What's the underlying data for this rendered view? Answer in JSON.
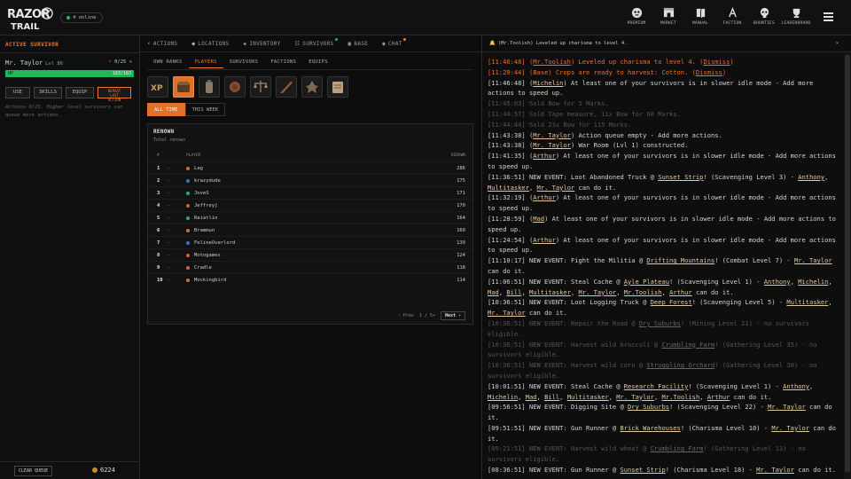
{
  "header": {
    "logo_text": "RAZOR TRAIL",
    "online_count": "4 online",
    "nav": [
      {
        "icon": "premium-icon",
        "label": "PREMIUM"
      },
      {
        "icon": "market-icon",
        "label": "MARKET"
      },
      {
        "icon": "manual-icon",
        "label": "MANUAL"
      },
      {
        "icon": "faction-icon",
        "label": "FACTION"
      },
      {
        "icon": "bounties-icon",
        "label": "BOUNTIES"
      },
      {
        "icon": "leaderboard-icon",
        "label": "LEADERBOARD"
      }
    ]
  },
  "left": {
    "title": "ACTIVE SURVIVOR",
    "survivor_name": "Mr. Taylor",
    "survivor_level": "Lvl 86",
    "actions": "0/25",
    "hp_label": "HP",
    "hp_value": "183/183",
    "hp_fraction": 1.0,
    "buttons": {
      "use": "USE",
      "skills": "SKILLS",
      "equip": "EQUIP",
      "repeat": "REPEAT LAST ACTION"
    },
    "note": "Actions 0/25. Higher level survivors can queue more actions.",
    "clear_queue": "CLEAR QUEUE",
    "coins": "6224"
  },
  "main": {
    "tabs": [
      {
        "icon": "⚡",
        "label": "ACTIONS"
      },
      {
        "icon": "●",
        "label": "LOCATIONS"
      },
      {
        "icon": "◈",
        "label": "INVENTORY"
      },
      {
        "icon": "☷",
        "label": "SURVIVORS"
      },
      {
        "icon": "▣",
        "label": "BASE"
      },
      {
        "icon": "◉",
        "label": "CHAT"
      }
    ],
    "subtabs": [
      "OWN RANKS",
      "PLAYERS",
      "SURVIVORS",
      "FACTIONS",
      "EQUIPS"
    ],
    "categories": [
      "xp-icon",
      "renown-crate-icon",
      "canteen-icon",
      "coin-icon",
      "scales-icon",
      "knife-icon",
      "creature-icon",
      "scroll-icon"
    ],
    "time_tabs": [
      "ALL TIME",
      "THIS WEEK"
    ],
    "board": {
      "title": "RENOWN",
      "subtitle": "Total renown",
      "col_rank": "#",
      "col_player": "PLAYER",
      "col_value": "RENOWN",
      "rows": [
        {
          "rank": "1",
          "change": "–",
          "color": "#c9713a",
          "name": "Lag",
          "value": "286"
        },
        {
          "rank": "2",
          "change": "–",
          "color": "#3a73c9",
          "name": "krazydude",
          "value": "175"
        },
        {
          "rank": "3",
          "change": "–",
          "color": "#1fb85a",
          "name": "JoveS",
          "value": "171"
        },
        {
          "rank": "4",
          "change": "–",
          "color": "#e05a40",
          "name": "Jeffreyj",
          "value": "170"
        },
        {
          "rank": "5",
          "change": "–",
          "color": "#1fb85a",
          "name": "Raiatlin",
          "value": "164"
        },
        {
          "rank": "6",
          "change": "–",
          "color": "#c9713a",
          "name": "Brammun",
          "value": "160"
        },
        {
          "rank": "7",
          "change": "–",
          "color": "#3a73c9",
          "name": "FelineOverlord",
          "value": "139"
        },
        {
          "rank": "8",
          "change": "–",
          "color": "#e05a40",
          "name": "Motogames",
          "value": "124"
        },
        {
          "rank": "9",
          "change": "–",
          "color": "#e05a40",
          "name": "Cradle",
          "value": "118"
        },
        {
          "rank": "10",
          "change": "–",
          "color": "#c9713a",
          "name": "Mockingbird",
          "value": "114"
        }
      ],
      "prev": "‹ Prev",
      "page": "1 / 5+",
      "next": "Next ›"
    }
  },
  "right": {
    "notice": "(Mr.Toolish) Leveled up charisma to level 4.",
    "close": "×",
    "log": [
      {
        "style": "orange",
        "html": "[11:46:48] (<span class=\"u\">Mr.Toolish</span>) Leveled up charisma to level 4. (<span class=\"u\">Dismiss</span>)"
      },
      {
        "style": "orange",
        "html": "[11:29:44] (Base) Crops are ready to harvest: Cotton. (<span class=\"u\">Dismiss</span>)"
      },
      {
        "style": "",
        "html": "[11:46:48] (<span class=\"u\">Michelin</span>) At least one of your survivors is in slower idle mode - Add more actions to speed up."
      },
      {
        "style": "dim",
        "html": "[11:45:03] Sold Bow for 5 Marks."
      },
      {
        "style": "dim",
        "html": "[11:44:57] Sold Tape measure, 11x Bow for 60 Marks."
      },
      {
        "style": "dim",
        "html": "[11:44:44] Sold 23x Bow for 115 Marks."
      },
      {
        "style": "",
        "html": "[11:43:38] (<span class=\"u\">Mr. Taylor</span>) Action queue empty - Add more actions."
      },
      {
        "style": "",
        "html": "[11:43:38] (<span class=\"u\">Mr. Taylor</span>) War Room (Lvl 1) constructed."
      },
      {
        "style": "",
        "html": "[11:41:35] (<span class=\"u\">Arthur</span>) At least one of your survivors is in slower idle mode - Add more actions to speed up."
      },
      {
        "style": "",
        "html": "[11:36:51] NEW EVENT: Loot Abandoned Truck @ <span class=\"u\">Sunset Strip</span>! (Scavenging Level 3) - <span class=\"u\">Anthony</span>, <span class=\"u\">Multitasker</span>, <span class=\"u\">Mr. Taylor</span> can do it."
      },
      {
        "style": "",
        "html": "[11:32:19] (<span class=\"u\">Arthur</span>) At least one of your survivors is in slower idle mode - Add more actions to speed up."
      },
      {
        "style": "",
        "html": "[11:28:59] (<span class=\"u\">Mad</span>) At least one of your survivors is in slower idle mode - Add more actions to speed up."
      },
      {
        "style": "",
        "html": "[11:24:54] (<span class=\"u\">Arthur</span>) At least one of your survivors is in slower idle mode - Add more actions to speed up."
      },
      {
        "style": "",
        "html": "[11:10:17] NEW EVENT: Fight the Militia @ <span class=\"u\">Drifting Mountains</span>! (Combat Level 7) - <span class=\"u\">Mr. Taylor</span> can do it."
      },
      {
        "style": "",
        "html": "[11:06:51] NEW EVENT: Steal Cache @ <span class=\"u\">Ayle Plateau</span>! (Scavenging Level 1) - <span class=\"u\">Anthony</span>, <span class=\"u\">Michelin</span>, <span class=\"u\">Mad</span>, <span class=\"u\">Bill</span>, <span class=\"u\">Multitasker</span>, <span class=\"u\">Mr. Taylor</span>, <span class=\"u\">Mr.Toolish</span>, <span class=\"u\">Arthur</span> can do it."
      },
      {
        "style": "",
        "html": "[10:36:51] NEW EVENT: Loot Logging Truck @ <span class=\"u\">Deep Forest</span>! (Scavenging Level 5) - <span class=\"u\">Multitasker</span>, <span class=\"u\">Mr. Taylor</span> can do it."
      },
      {
        "style": "dim",
        "html": "[10:36:51] NEW EVENT: Repair the Road @ <span class=\"u\">Dry Suburbs</span>! (Mining Level 21) - no survivors eligible."
      },
      {
        "style": "dim",
        "html": "[10:36:51] NEW EVENT: Harvest wild broccoli @ <span class=\"u\">Crumbling Farm</span>! (Gathering Level 35) - no survivors eligible."
      },
      {
        "style": "dim",
        "html": "[10:36:51] NEW EVENT: Harvest wild corn @ <span class=\"u\">Struggling Orchard</span>! (Gathering Level 30) - no survivors eligible."
      },
      {
        "style": "",
        "html": "[10:01:51] NEW EVENT: Steal Cache @ <span class=\"u\">Research Facility</span>! (Scavenging Level 1) - <span class=\"u\">Anthony</span>, <span class=\"u\">Michelin</span>, <span class=\"u\">Mad</span>, <span class=\"u\">Bill</span>, <span class=\"u\">Multitasker</span>, <span class=\"u\">Mr. Taylor</span>, <span class=\"u\">Mr.Toolish</span>, <span class=\"u\">Arthur</span> can do it."
      },
      {
        "style": "",
        "html": "[09:56:51] NEW EVENT: Digging Site @ <span class=\"u\">Dry Suburbs</span>! (Scavenging Level 22) - <span class=\"u\">Mr. Taylor</span> can do it."
      },
      {
        "style": "",
        "html": "[09:51:51] NEW EVENT: Gun Runner @ <span class=\"u\">Brick Warehouses</span>! (Charisma Level 10) - <span class=\"u\">Mr. Taylor</span> can do it."
      },
      {
        "style": "dim",
        "html": "[09:21:51] NEW EVENT: Harvest wild wheat @ <span class=\"u\">Crumbling Farm</span>! (Gathering Level 13) - no survivors eligible."
      },
      {
        "style": "",
        "html": "[08:36:51] NEW EVENT: Gun Runner @ <span class=\"u\">Sunset Strip</span>! (Charisma Level 18) - <span class=\"u\">Mr. Taylor</span> can do it."
      }
    ]
  }
}
